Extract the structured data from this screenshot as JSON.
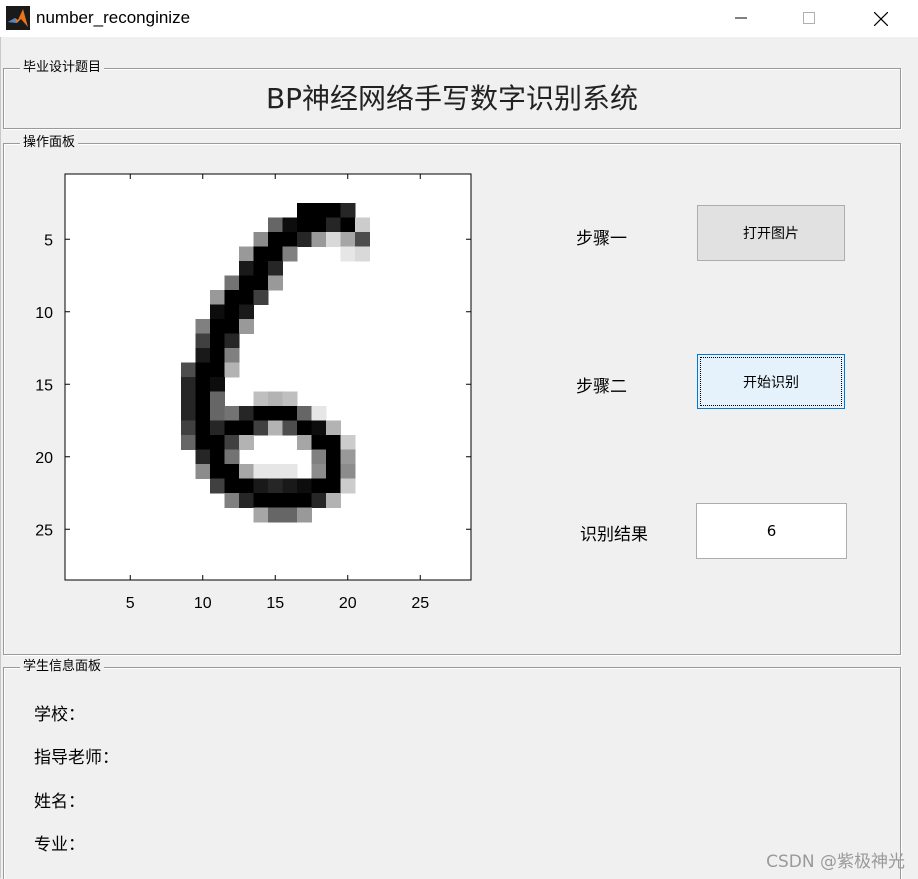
{
  "window": {
    "title": "number_reconginize",
    "icon": "matlab-icon"
  },
  "title_panel": {
    "label": "毕业设计题目",
    "heading": "BP神经网络手写数字识别系统"
  },
  "operation_panel": {
    "label": "操作面板",
    "step1_label": "步骤一",
    "open_button": "打开图片",
    "step2_label": "步骤二",
    "recognize_button": "开始识别",
    "result_label": "识别结果",
    "result_value": "6"
  },
  "image_axes": {
    "x_ticks": [
      "5",
      "10",
      "15",
      "20",
      "25"
    ],
    "y_ticks": [
      "5",
      "10",
      "15",
      "20",
      "25"
    ],
    "digit": "6",
    "grid_size": 28
  },
  "student_panel": {
    "label": "学生信息面板",
    "school": "学校：",
    "advisor": "指导老师：",
    "name": "姓名：",
    "major": "专业："
  },
  "watermark": "CSDN @紫极神光"
}
